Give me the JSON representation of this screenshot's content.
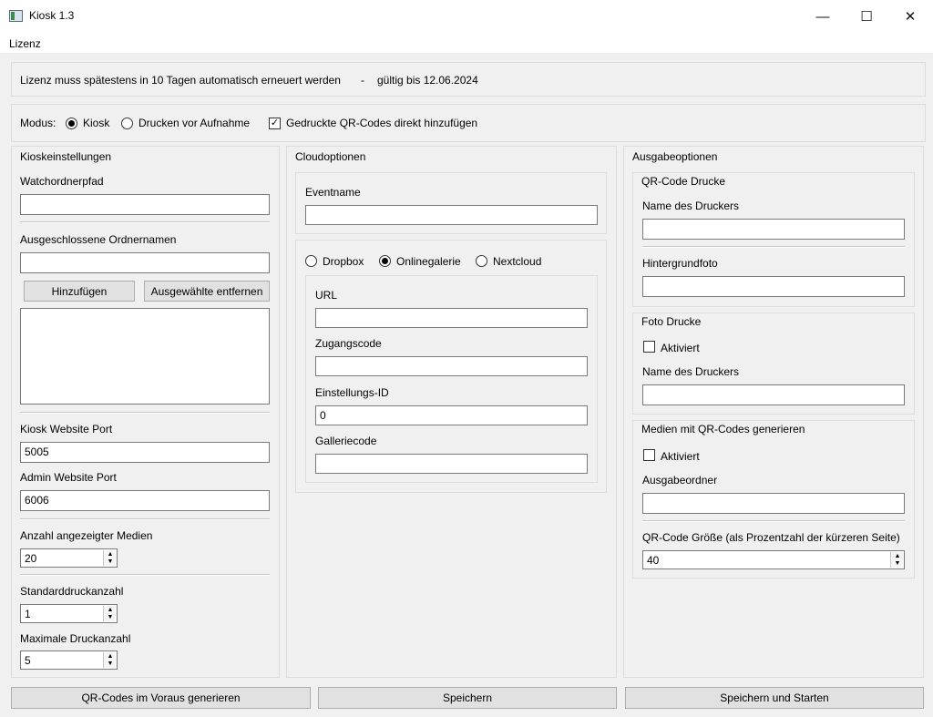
{
  "window": {
    "title": "Kiosk 1.3",
    "minimize": "—",
    "maximize": "☐",
    "close": "✕"
  },
  "menu": {
    "items": [
      "Lizenz"
    ]
  },
  "license": {
    "message": "Lizenz muss spätestens in 10 Tagen automatisch erneuert werden",
    "dash": "-",
    "valid_until": "gültig bis 12.06.2024"
  },
  "mode": {
    "label": "Modus:",
    "options": [
      "Kiosk",
      "Drucken vor Aufnahme"
    ],
    "selected": "Kiosk",
    "qr_checkbox_label": "Gedruckte QR-Codes direkt hinzufügen",
    "qr_checkbox_checked": true
  },
  "kiosk": {
    "group_title": "Kioskeinstellungen",
    "watch_folder_label": "Watchordnerpfad",
    "watch_folder_value": "",
    "excluded_label": "Ausgeschlossene Ordnernamen",
    "excluded_value": "",
    "add_button": "Hinzufügen",
    "remove_button": "Ausgewählte entfernen",
    "excluded_list": [],
    "kiosk_port_label": "Kiosk Website Port",
    "kiosk_port_value": "5005",
    "admin_port_label": "Admin Website Port",
    "admin_port_value": "6006",
    "media_count_label": "Anzahl angezeigter Medien",
    "media_count_value": "20",
    "default_print_label": "Standarddruckanzahl",
    "default_print_value": "1",
    "max_print_label": "Maximale Druckanzahl",
    "max_print_value": "5"
  },
  "cloud": {
    "group_title": "Cloudoptionen",
    "event_name_label": "Eventname",
    "event_name_value": "",
    "providers": [
      "Dropbox",
      "Onlinegalerie",
      "Nextcloud"
    ],
    "selected_provider": "Onlinegalerie",
    "url_label": "URL",
    "url_value": "",
    "access_code_label": "Zugangscode",
    "access_code_value": "",
    "settings_id_label": "Einstellungs-ID",
    "settings_id_value": "0",
    "gallery_code_label": "Galleriecode",
    "gallery_code_value": ""
  },
  "output": {
    "group_title": "Ausgabeoptionen",
    "qr_prints_title": "QR-Code Drucke",
    "qr_printer_label": "Name des Druckers",
    "qr_printer_value": "",
    "background_label": "Hintergrundfoto",
    "background_value": "",
    "photo_prints_title": "Foto Drucke",
    "photo_enabled_label": "Aktiviert",
    "photo_enabled": false,
    "photo_printer_label": "Name des Druckers",
    "photo_printer_value": "",
    "media_qr_title": "Medien mit QR-Codes generieren",
    "media_qr_enabled_label": "Aktiviert",
    "media_qr_enabled": false,
    "output_folder_label": "Ausgabeordner",
    "output_folder_value": "",
    "qr_size_label": "QR-Code Größe (als Prozentzahl der kürzeren Seite)",
    "qr_size_value": "40"
  },
  "footer": {
    "pregenerate_button": "QR-Codes im Voraus generieren",
    "save_button": "Speichern",
    "save_start_button": "Speichern und Starten"
  },
  "spin": {
    "up": "▲",
    "down": "▼"
  }
}
